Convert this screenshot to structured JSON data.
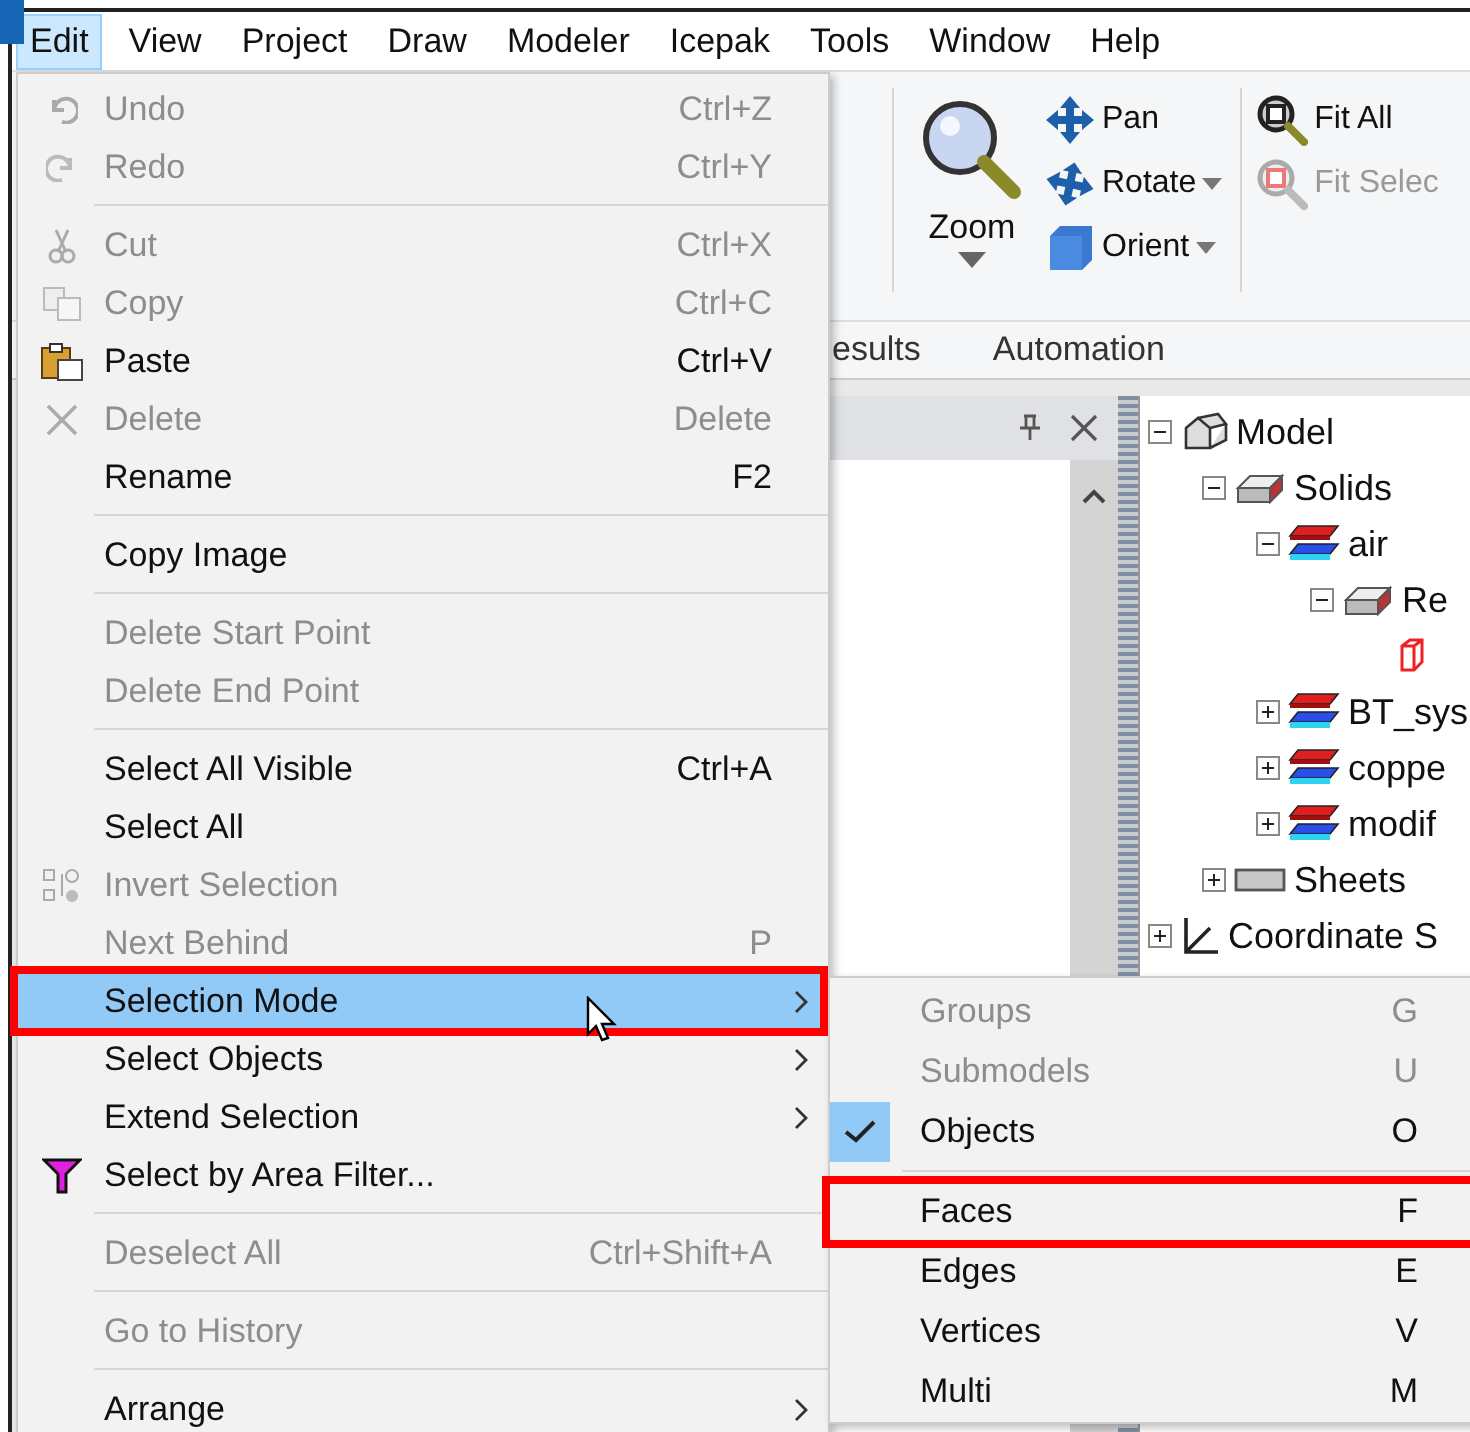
{
  "menu_bar": [
    {
      "label": "Edit",
      "selected": true
    },
    {
      "label": "View",
      "selected": false
    },
    {
      "label": "Project",
      "selected": false
    },
    {
      "label": "Draw",
      "selected": false
    },
    {
      "label": "Modeler",
      "selected": false
    },
    {
      "label": "Icepak",
      "selected": false
    },
    {
      "label": "Tools",
      "selected": false
    },
    {
      "label": "Window",
      "selected": false
    },
    {
      "label": "Help",
      "selected": false
    }
  ],
  "ribbon": {
    "zoom": {
      "label": "Zoom"
    },
    "view_tools": [
      {
        "kind": "pan",
        "label": "Pan",
        "dropdown": false
      },
      {
        "kind": "rotate",
        "label": "Rotate",
        "dropdown": true
      },
      {
        "kind": "orient",
        "label": "Orient",
        "dropdown": true
      }
    ],
    "fit_tools": [
      {
        "kind": "fit_all",
        "label": "Fit All",
        "disabled": false
      },
      {
        "kind": "fit_selection",
        "label": "Fit Selec",
        "disabled": true
      }
    ],
    "tabs": [
      {
        "label": "esults"
      },
      {
        "label": "Automation"
      }
    ]
  },
  "tree": [
    {
      "kind": "model",
      "label": "Model",
      "expanded": true,
      "children": [
        {
          "kind": "group",
          "label": "Solids",
          "expanded": true,
          "children": [
            {
              "kind": "solid",
              "label": "air",
              "expanded": true,
              "children": [
                {
                  "kind": "group",
                  "label": "Re",
                  "expanded": true,
                  "children": [
                    {
                      "kind": "face"
                    }
                  ]
                }
              ]
            },
            {
              "kind": "solid",
              "label": "BT_sys",
              "expanded": false
            },
            {
              "kind": "solid",
              "label": "coppe",
              "expanded": false
            },
            {
              "kind": "solid",
              "label": "modif",
              "expanded": false
            }
          ]
        },
        {
          "kind": "sheet",
          "label": "Sheets",
          "expanded": false
        }
      ]
    },
    {
      "kind": "coordinate",
      "label": "Coordinate S",
      "expanded": false
    }
  ],
  "edit_menu": [
    {
      "kind": "undo",
      "label": "Undo",
      "shortcut": "Ctrl+Z",
      "disabled": true
    },
    {
      "kind": "redo",
      "label": "Redo",
      "shortcut": "Ctrl+Y",
      "disabled": true
    },
    {
      "kind": "separator"
    },
    {
      "kind": "cut",
      "label": "Cut",
      "shortcut": "Ctrl+X",
      "disabled": true
    },
    {
      "kind": "copy",
      "label": "Copy",
      "shortcut": "Ctrl+C",
      "disabled": true
    },
    {
      "kind": "paste",
      "label": "Paste",
      "shortcut": "Ctrl+V",
      "disabled": false
    },
    {
      "kind": "delete",
      "label": "Delete",
      "shortcut": "Delete",
      "disabled": true
    },
    {
      "kind": "plain",
      "label": "Rename",
      "shortcut": "F2",
      "disabled": false
    },
    {
      "kind": "separator"
    },
    {
      "kind": "plain",
      "label": "Copy Image",
      "disabled": false
    },
    {
      "kind": "separator"
    },
    {
      "kind": "plain",
      "label": "Delete Start Point",
      "disabled": true
    },
    {
      "kind": "plain",
      "label": "Delete End Point",
      "disabled": true
    },
    {
      "kind": "separator"
    },
    {
      "kind": "plain",
      "label": "Select All Visible",
      "shortcut": "Ctrl+A",
      "disabled": false
    },
    {
      "kind": "plain",
      "label": "Select All",
      "disabled": false
    },
    {
      "kind": "invert",
      "label": "Invert Selection",
      "disabled": true
    },
    {
      "kind": "plain",
      "label": "Next Behind",
      "shortcut": "P",
      "disabled": true
    },
    {
      "kind": "plain",
      "label": "Selection Mode",
      "submenu": true,
      "disabled": false,
      "selected": true,
      "annotated": true
    },
    {
      "kind": "plain",
      "label": "Select Objects",
      "submenu": true,
      "disabled": false,
      "selected": false
    },
    {
      "kind": "plain",
      "label": "Extend Selection",
      "submenu": true,
      "disabled": false,
      "selected": false
    },
    {
      "kind": "filter",
      "label": "Select by Area Filter...",
      "disabled": false
    },
    {
      "kind": "separator"
    },
    {
      "kind": "plain",
      "label": "Deselect All",
      "shortcut": "Ctrl+Shift+A",
      "disabled": true
    },
    {
      "kind": "separator"
    },
    {
      "kind": "plain",
      "label": "Go to History",
      "disabled": true
    },
    {
      "kind": "separator"
    },
    {
      "kind": "plain",
      "label": "Arrange",
      "submenu": true,
      "disabled": false,
      "selected": false
    }
  ],
  "selection_mode_menu": [
    {
      "kind": "item",
      "label": "Groups",
      "shortcut": "G",
      "disabled": true,
      "checked": false
    },
    {
      "kind": "item",
      "label": "Submodels",
      "shortcut": "U",
      "disabled": true,
      "checked": false
    },
    {
      "kind": "item",
      "label": "Objects",
      "shortcut": "O",
      "disabled": false,
      "checked": true
    },
    {
      "kind": "separator"
    },
    {
      "kind": "item",
      "label": "Faces",
      "shortcut": "F",
      "disabled": false,
      "checked": false,
      "annotated": true
    },
    {
      "kind": "item",
      "label": "Edges",
      "shortcut": "E",
      "disabled": false,
      "checked": false
    },
    {
      "kind": "item",
      "label": "Vertices",
      "shortcut": "V",
      "disabled": false,
      "checked": false
    },
    {
      "kind": "item",
      "label": "Multi",
      "shortcut": "M",
      "disabled": false,
      "checked": false
    }
  ]
}
